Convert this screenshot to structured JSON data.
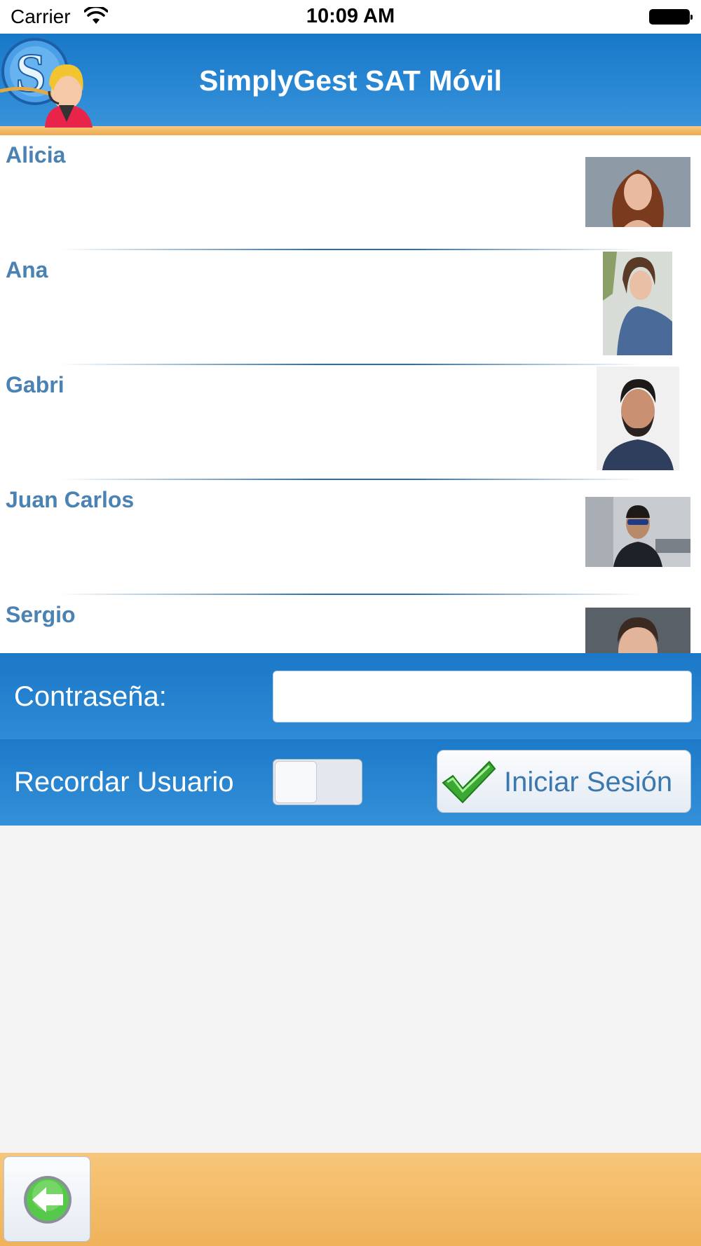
{
  "status_bar": {
    "carrier": "Carrier",
    "time": "10:09 AM"
  },
  "header": {
    "title": "SimplyGest SAT Móvil",
    "logo_icon": "support-agent-logo-icon",
    "color": "#2a88d4",
    "stripe_color": "#f0b25a"
  },
  "users": [
    {
      "name": "Alicia",
      "avatar": "woman-red-hair-photo"
    },
    {
      "name": "Ana",
      "avatar": "woman-denim-shirt-photo"
    },
    {
      "name": "Gabri",
      "avatar": "man-beard-photo"
    },
    {
      "name": "Juan Carlos",
      "avatar": "man-sunglasses-photo"
    },
    {
      "name": "Sergio",
      "avatar": "man-short-hair-photo"
    }
  ],
  "login": {
    "password_label": "Contraseña:",
    "password_value": "",
    "remember_label": "Recordar Usuario",
    "remember_on": false,
    "login_button_label": "Iniciar Sesión",
    "login_icon": "green-checkmark-icon",
    "accent_color": "#3b78b0"
  },
  "footer": {
    "back_icon": "green-back-arrow-icon"
  }
}
